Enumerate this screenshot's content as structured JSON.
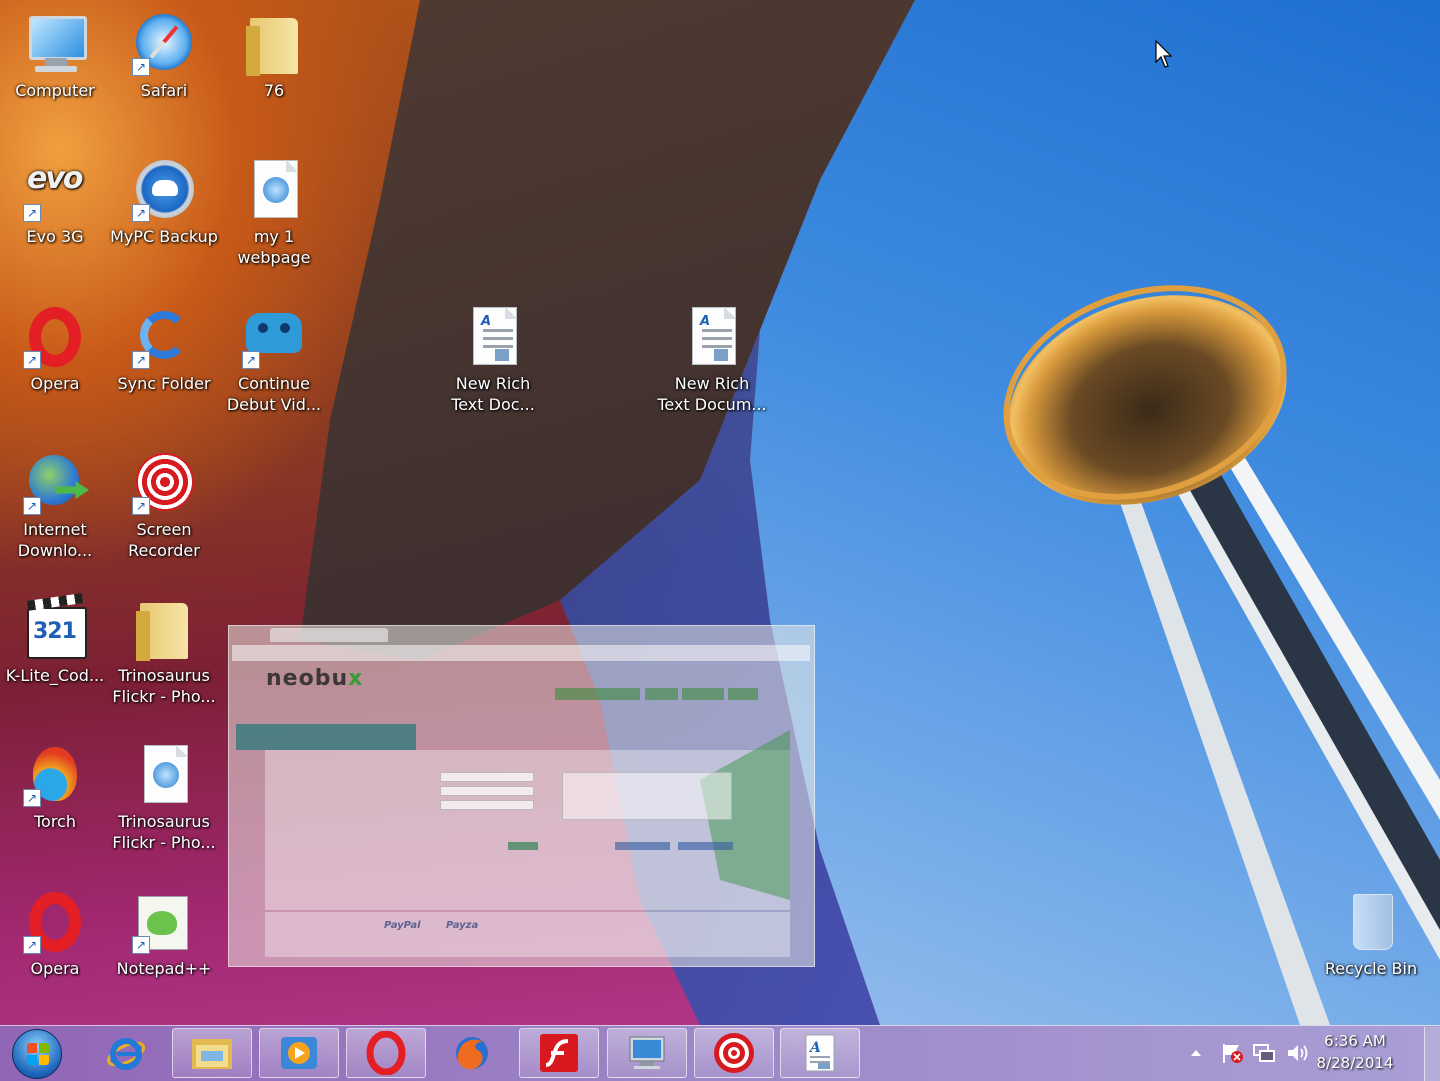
{
  "desktop": {
    "icons": [
      {
        "label": "Computer",
        "icon": "computer-icon"
      },
      {
        "label": "Safari",
        "icon": "safari-icon"
      },
      {
        "label": "76",
        "icon": "folder-icon"
      },
      {
        "label": "Evo 3G",
        "icon": "evo-icon"
      },
      {
        "label": "MyPC Backup",
        "icon": "backup-cloud-icon"
      },
      {
        "label": "my 1\nwebpage",
        "icon": "safari-page-icon"
      },
      {
        "label": "Opera",
        "icon": "opera-icon"
      },
      {
        "label": "Sync Folder",
        "icon": "sync-icon"
      },
      {
        "label": "Continue\nDebut Vid...",
        "icon": "debut-video-icon"
      },
      {
        "label": "New Rich\nText Doc...",
        "icon": "rich-text-document-icon"
      },
      {
        "label": "New Rich\nText Docum...",
        "icon": "rich-text-document-icon"
      },
      {
        "label": "Internet\nDownlo...",
        "icon": "internet-download-manager-icon"
      },
      {
        "label": "Screen\nRecorder",
        "icon": "screen-recorder-icon"
      },
      {
        "label": "K-Lite_Cod...",
        "icon": "codec-clapper-icon"
      },
      {
        "label": "Trinosaurus\nFlickr - Pho...",
        "icon": "folder-icon"
      },
      {
        "label": "Torch",
        "icon": "torch-browser-icon"
      },
      {
        "label": "Trinosaurus\nFlickr - Pho...",
        "icon": "safari-page-icon"
      },
      {
        "label": "Opera",
        "icon": "opera-icon"
      },
      {
        "label": "Notepad++",
        "icon": "notepad-plus-plus-icon"
      },
      {
        "label": "Recycle Bin",
        "icon": "recycle-bin-icon"
      }
    ]
  },
  "ghost_window": {
    "brand": "neobu",
    "brand_x": "x",
    "payments": [
      "PayPal",
      "Payza"
    ]
  },
  "taskbar": {
    "pinned": [
      {
        "name": "internet-explorer",
        "icon": "internet-explorer-icon"
      },
      {
        "name": "file-explorer",
        "icon": "file-explorer-icon"
      },
      {
        "name": "media-player",
        "icon": "media-player-icon"
      },
      {
        "name": "opera",
        "icon": "opera-icon"
      },
      {
        "name": "firefox",
        "icon": "firefox-icon"
      },
      {
        "name": "flash",
        "icon": "flash-icon"
      },
      {
        "name": "remote-desktop",
        "icon": "monitor-icon"
      },
      {
        "name": "screen-recorder",
        "icon": "screen-recorder-icon"
      },
      {
        "name": "wordpad",
        "icon": "wordpad-icon"
      }
    ],
    "clock": {
      "time": "6:36 AM",
      "date": "8/28/2014"
    }
  },
  "colors": {
    "opera_red": "#e31e24",
    "taskbar_tint": "#b08ccc",
    "sky_blue": "#3e8be0"
  }
}
